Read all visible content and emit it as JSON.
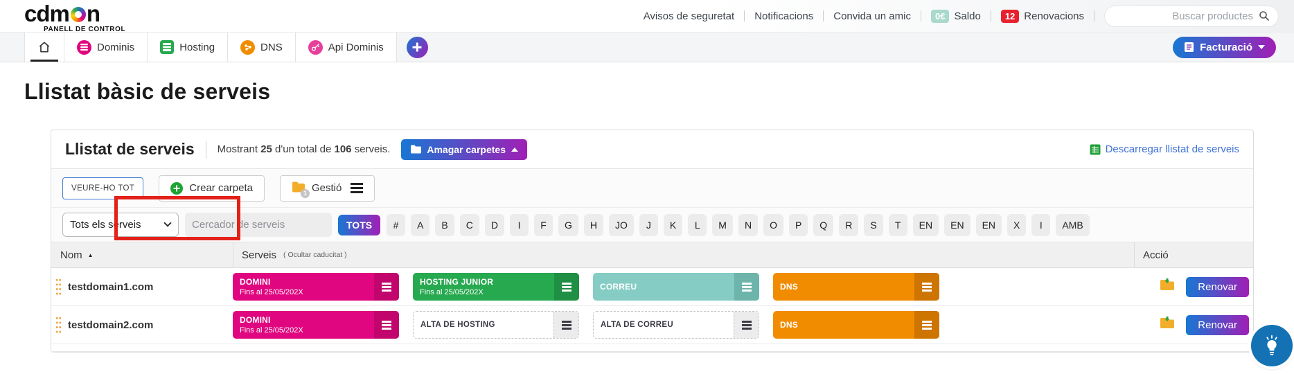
{
  "header": {
    "logo": {
      "pre": "cd",
      "mid": "m",
      "post": "n",
      "subtitle": "PANELL DE CONTROL"
    },
    "links": [
      "Avisos de seguretat",
      "Notificacions",
      "Convida un amic"
    ],
    "saldo": {
      "badge": "0€",
      "label": "Saldo"
    },
    "renovacions": {
      "badge": "12",
      "label": "Renovacions"
    },
    "search": {
      "placeholder": "Buscar productes"
    }
  },
  "nav": {
    "tabs": [
      {
        "id": "home",
        "label": ""
      },
      {
        "id": "dominis",
        "label": "Dominis"
      },
      {
        "id": "hosting",
        "label": "Hosting"
      },
      {
        "id": "dns",
        "label": "DNS"
      },
      {
        "id": "api-dominis",
        "label": "Api Dominis"
      }
    ],
    "billing_label": "Facturació"
  },
  "page": {
    "title": "Llistat bàsic de serveis"
  },
  "panel": {
    "title": "Llistat de serveis",
    "summary": {
      "lead": "Mostrant",
      "shown": "25",
      "middle": "d'un total de",
      "total": "106",
      "tail": "serveis."
    },
    "hide_folders_label": "Amagar carpetes",
    "download_label": "Descarregar llistat de serveis",
    "toolbar": {
      "view_all_label": "VEURE-HO TOT",
      "create_folder_label": "Crear carpeta",
      "manage_label": "Gestió",
      "manage_badge": "1"
    },
    "filters": {
      "select_value": "Tots els serveis",
      "search_placeholder": "Cercador de serveis",
      "all_label": "TOTS",
      "letters": [
        "#",
        "A",
        "B",
        "C",
        "D",
        "I",
        "F",
        "G",
        "H",
        "JO",
        "J",
        "K",
        "L",
        "M",
        "N",
        "O",
        "P",
        "Q",
        "R",
        "S",
        "T",
        "EN",
        "EN",
        "EN",
        "X",
        "I",
        "AMB"
      ]
    },
    "table": {
      "columns": {
        "nom": "Nom",
        "serveis": "Serveis",
        "serveis_note": "( Ocultar caducitat )",
        "accio": "Acció"
      },
      "rows": [
        {
          "name": "testdomain1.com",
          "services": [
            {
              "label": "DOMINI",
              "sub": "Fins al 25/05/202X"
            },
            {
              "label": "HOSTING JUNIOR",
              "sub": "Fins al 25/05/202X"
            },
            {
              "label": "CORREU",
              "sub": ""
            },
            {
              "label": "DNS",
              "sub": ""
            }
          ],
          "renew_label": "Renovar"
        },
        {
          "name": "testdomain2.com",
          "services": [
            {
              "label": "DOMINI",
              "sub": "Fins al 25/05/202X"
            },
            {
              "label": "ALTA DE HOSTING",
              "sub": ""
            },
            {
              "label": "ALTA DE CORREU",
              "sub": ""
            },
            {
              "label": "DNS",
              "sub": ""
            }
          ],
          "renew_label": "Renovar"
        }
      ]
    }
  },
  "colors": {
    "pink": "#e0067f",
    "pink_dark": "#c2056d",
    "green": "#27a950",
    "green_dark": "#1f8f43",
    "teal": "#84ccc4",
    "teal_dark": "#6db4aa",
    "orange": "#f18c00",
    "orange_dark": "#cd7500",
    "grad_from": "#1877d3",
    "grad_to": "#a01fb5",
    "red_badge": "#e7222e",
    "saldo_badge": "#a9d8cc",
    "annotation_red": "#e32119",
    "link_blue": "#3f72d8",
    "folder_yellow": "#f2ae2a",
    "bulb_blue": "#1371b4",
    "icon_green": "#1ea433"
  }
}
